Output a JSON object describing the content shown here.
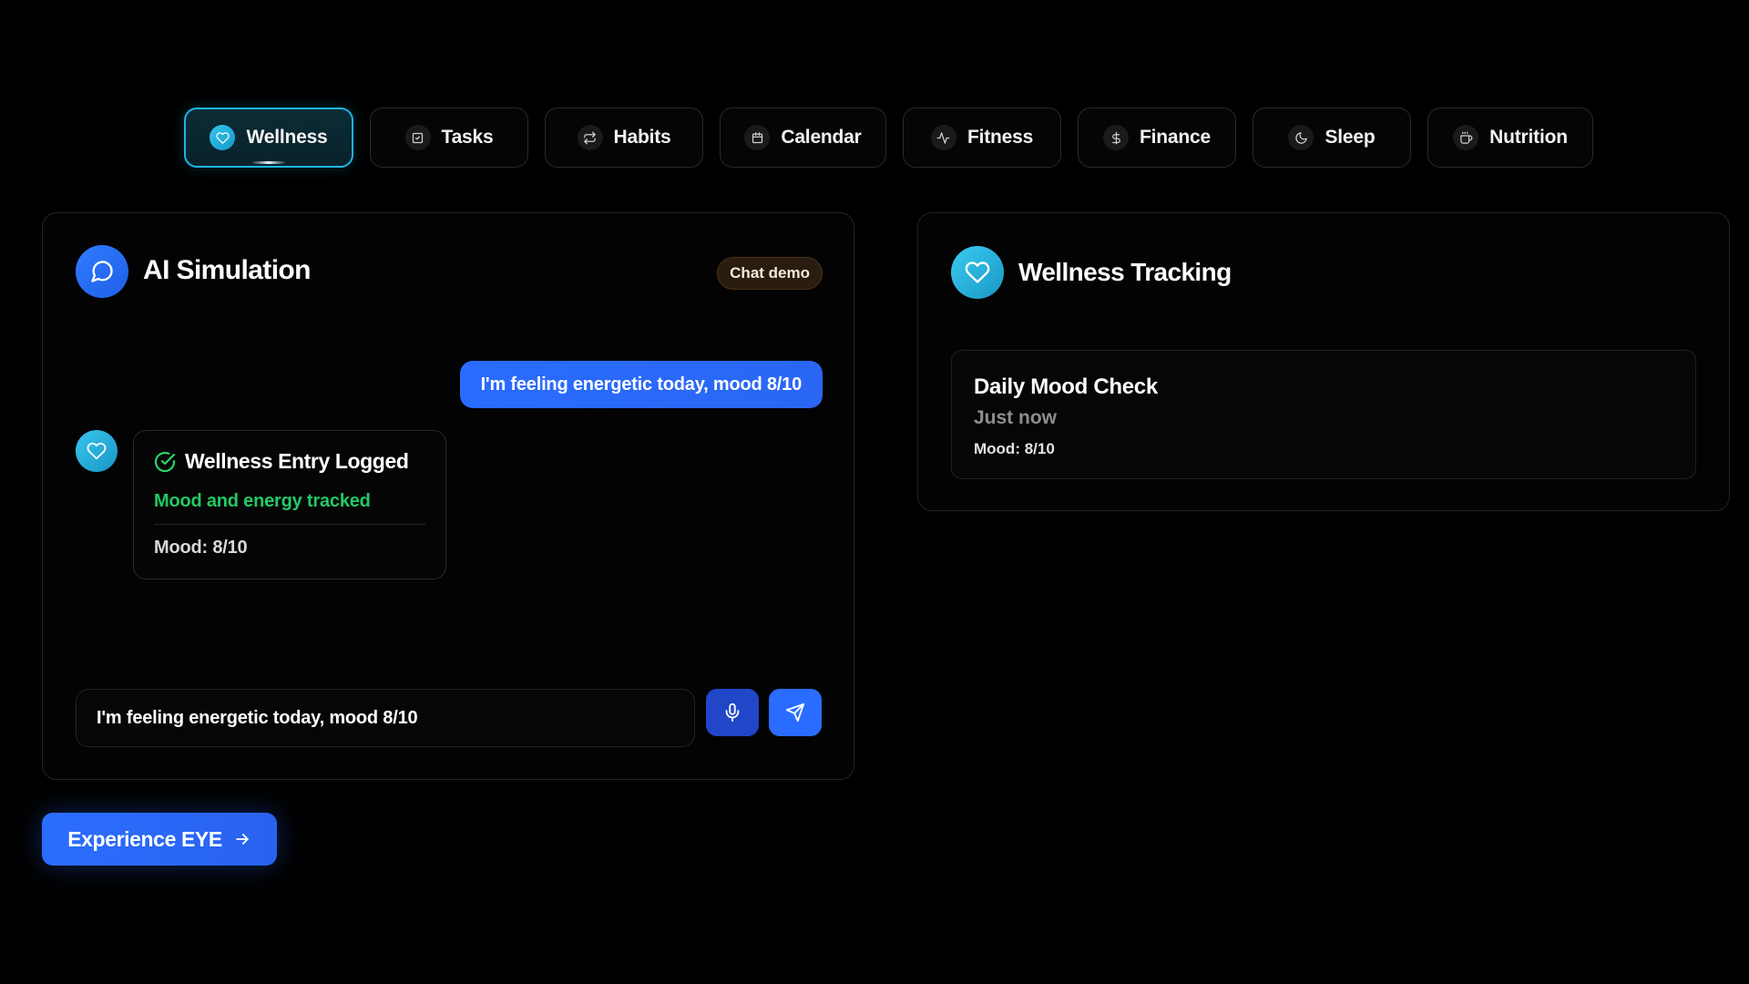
{
  "tabs": [
    {
      "label": "Wellness",
      "icon": "heart-icon",
      "active": true
    },
    {
      "label": "Tasks",
      "icon": "checkbox-icon",
      "active": false
    },
    {
      "label": "Habits",
      "icon": "repeat-icon",
      "active": false
    },
    {
      "label": "Calendar",
      "icon": "calendar-icon",
      "active": false
    },
    {
      "label": "Fitness",
      "icon": "activity-icon",
      "active": false
    },
    {
      "label": "Finance",
      "icon": "dollar-icon",
      "active": false
    },
    {
      "label": "Sleep",
      "icon": "moon-icon",
      "active": false
    },
    {
      "label": "Nutrition",
      "icon": "coffee-icon",
      "active": false
    }
  ],
  "simulation": {
    "title": "AI Simulation",
    "badge": "Chat demo",
    "user_message": "I'm feeling energetic today, mood 8/10",
    "bot_card": {
      "title": "Wellness Entry Logged",
      "subtitle": "Mood and energy tracked",
      "detail": "Mood: 8/10"
    },
    "input_value": "I'm feeling energetic today, mood 8/10"
  },
  "tracking": {
    "title": "Wellness Tracking",
    "entry": {
      "title": "Daily Mood Check",
      "time": "Just now",
      "detail": "Mood: 8/10"
    }
  },
  "cta": {
    "label": "Experience EYE"
  },
  "colors": {
    "accent_blue": "#2a6cff",
    "accent_cyan": "#1db4e4",
    "success_green": "#24c965",
    "background": "#000000"
  }
}
